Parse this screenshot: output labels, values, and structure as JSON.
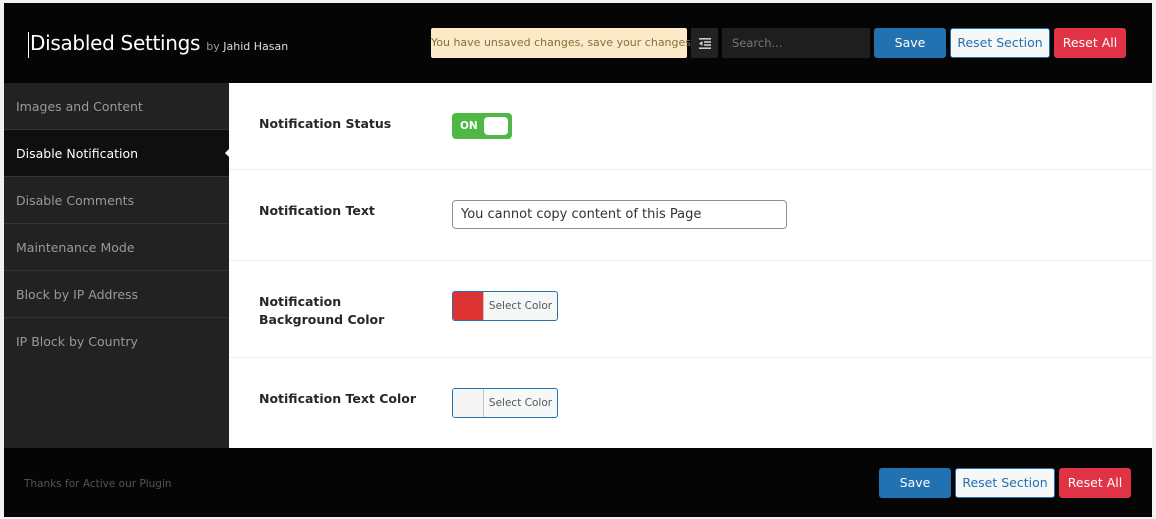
{
  "header": {
    "title": "Disabled Settings",
    "by_prefix": "by",
    "author": "Jahid Hasan",
    "notice": "You have unsaved changes, save your changes!",
    "expand_icon": "indent-toggle-icon",
    "search_placeholder": "Search...",
    "search_value": "",
    "save_label": "Save",
    "reset_section_label": "Reset Section",
    "reset_all_label": "Reset All"
  },
  "sidebar": {
    "items": [
      {
        "label": "Images and Content",
        "active": false
      },
      {
        "label": "Disable Notification",
        "active": true
      },
      {
        "label": "Disable Comments",
        "active": false
      },
      {
        "label": "Maintenance Mode",
        "active": false
      },
      {
        "label": "Block by IP Address",
        "active": false
      },
      {
        "label": "IP Block by Country",
        "active": false
      }
    ]
  },
  "main": {
    "fields": [
      {
        "label": "Notification Status",
        "type": "switch",
        "value": "ON"
      },
      {
        "label": "Notification Text",
        "type": "text",
        "value": "You cannot copy content of this Page"
      },
      {
        "label": "Notification Background Color",
        "type": "color",
        "value": "#dd3333",
        "button_label": "Select Color"
      },
      {
        "label": "Notification Text Color",
        "type": "color",
        "value": "#f5f5f5",
        "button_label": "Select Color"
      }
    ]
  },
  "footer": {
    "text": "Thanks for Active our Plugin",
    "save_label": "Save",
    "reset_section_label": "Reset Section",
    "reset_all_label": "Reset All"
  },
  "colors": {
    "primary": "#2271b1",
    "danger": "#e03446",
    "toggle_on": "#4fb845",
    "notice_bg": "#fbe9c8"
  }
}
